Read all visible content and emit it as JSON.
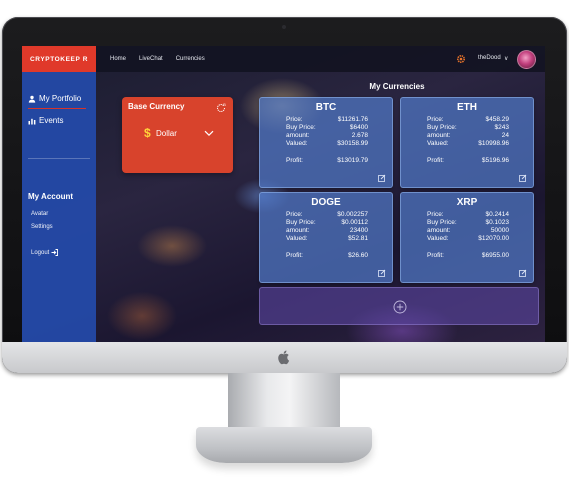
{
  "topbar": {
    "brand": "CRYPTOKEEP R",
    "nav": [
      "Home",
      "LiveChat",
      "Currencies"
    ],
    "user_name": "theDood",
    "user_chevron": "∨"
  },
  "sidebar": {
    "items": [
      {
        "label": "My Portfolio",
        "icon": "person-icon"
      },
      {
        "label": "Events",
        "icon": "chart-icon"
      }
    ],
    "account_heading": "My Account",
    "account_items": [
      "Avatar",
      "Settings"
    ],
    "logout_label": "Logout"
  },
  "base_currency": {
    "title": "Base Currency",
    "symbol": "$",
    "selected": "Dollar",
    "refresh_badge": "B"
  },
  "main": {
    "title": "My Currencies",
    "coins": [
      {
        "symbol": "BTC",
        "price": "$11261.76",
        "buy_price": "$6400",
        "amount": "2.678",
        "valued": "$30158.99",
        "profit": "$13019.79"
      },
      {
        "symbol": "ETH",
        "price": "$458.29",
        "buy_price": "$243",
        "amount": "24",
        "valued": "$10998.96",
        "profit": "$5196.96"
      },
      {
        "symbol": "DOGE",
        "price": "$0.002257",
        "buy_price": "$0.00112",
        "amount": "23400",
        "valued": "$52.81",
        "profit": "$26.60"
      },
      {
        "symbol": "XRP",
        "price": "$0.2414",
        "buy_price": "$0.1023",
        "amount": "50000",
        "valued": "$12070.00",
        "profit": "$6955.00"
      }
    ],
    "labels": {
      "price": "Price:",
      "buy_price": "Buy Price:",
      "amount": "amount:",
      "valued": "Valued:",
      "profit": "Profit:"
    }
  },
  "colors": {
    "brand_red": "#e0392a",
    "sidebar_blue": "#244aaa",
    "card_blue": "#5078c8",
    "base_card": "#d8432c"
  }
}
